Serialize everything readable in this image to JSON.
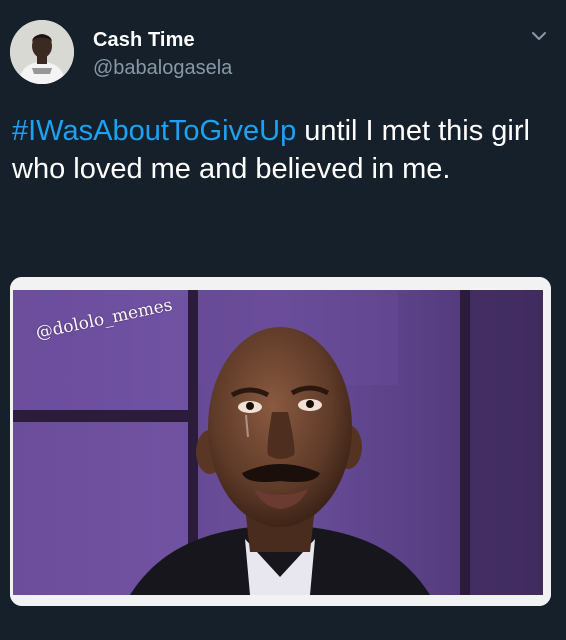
{
  "tweet": {
    "display_name": "Cash Time",
    "handle": "@babalogasela",
    "hashtag": "#IWasAboutToGiveUp",
    "text_after_hashtag": " until I met this girl who loved me and believed in me.",
    "menu_icon": "chevron-down-icon",
    "avatar_icon": "avatar"
  },
  "media": {
    "watermark": "@dololo_memes"
  },
  "colors": {
    "background": "#15202b",
    "hashtag": "#1da1f2",
    "secondary_text": "#8899a6"
  }
}
